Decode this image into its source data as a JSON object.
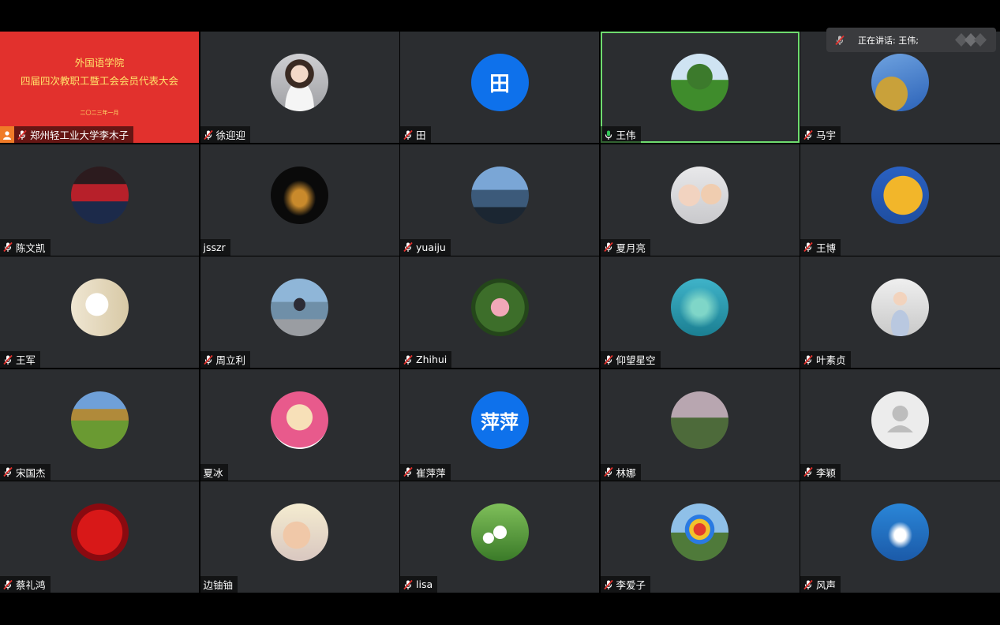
{
  "speaking": {
    "text": "正在讲话: 王伟;",
    "mic_icon": "muted-mic-icon",
    "logo": "app-logo"
  },
  "share": {
    "title_line1": "外国语学院",
    "title_line2": "四届四次教职工暨工会会员代表大会",
    "date": "二〇二三年一月",
    "name": "郑州轻工业大学李木子",
    "host_icon": "person-icon",
    "mic_icon": "muted-mic-icon",
    "bg_color": "#e2312d",
    "title_color": "#ffe36a"
  },
  "participants": [
    {
      "name": "徐迎迎",
      "mic": "muted",
      "avatar": "photo",
      "avatar_kind": "woman-portrait"
    },
    {
      "name": "田",
      "mic": "muted",
      "avatar": "text",
      "avatar_text": "田"
    },
    {
      "name": "王伟",
      "mic": "speaking",
      "avatar": "photo",
      "avatar_kind": "tree",
      "active": true
    },
    {
      "name": "马宇",
      "mic": "muted",
      "avatar": "photo",
      "avatar_kind": "autumn-trees"
    },
    {
      "name": "陈文凯",
      "mic": "muted",
      "avatar": "photo",
      "avatar_kind": "auditorium"
    },
    {
      "name": "jsszr",
      "mic": "none",
      "avatar": "photo",
      "avatar_kind": "calligraphy"
    },
    {
      "name": "yuaiju",
      "mic": "muted",
      "avatar": "photo",
      "avatar_kind": "city"
    },
    {
      "name": "夏月亮",
      "mic": "muted",
      "avatar": "photo",
      "avatar_kind": "mother-child"
    },
    {
      "name": "王博",
      "mic": "muted",
      "avatar": "photo",
      "avatar_kind": "ginkgo"
    },
    {
      "name": "王军",
      "mic": "muted",
      "avatar": "photo",
      "avatar_kind": "lily"
    },
    {
      "name": "周立利",
      "mic": "muted",
      "avatar": "photo",
      "avatar_kind": "seaside"
    },
    {
      "name": "Zhihui",
      "mic": "muted",
      "avatar": "photo",
      "avatar_kind": "rose"
    },
    {
      "name": "仰望星空",
      "mic": "muted",
      "avatar": "photo",
      "avatar_kind": "teal-sky"
    },
    {
      "name": "叶素贞",
      "mic": "muted",
      "avatar": "photo",
      "avatar_kind": "child"
    },
    {
      "name": "宋国杰",
      "mic": "muted",
      "avatar": "photo",
      "avatar_kind": "field"
    },
    {
      "name": "夏冰",
      "mic": "none",
      "avatar": "photo",
      "avatar_kind": "cartoon"
    },
    {
      "name": "崔萍萍",
      "mic": "muted",
      "avatar": "text",
      "avatar_text": "萍萍"
    },
    {
      "name": "林娜",
      "mic": "muted",
      "avatar": "photo",
      "avatar_kind": "forest"
    },
    {
      "name": "李颖",
      "mic": "muted",
      "avatar": "photo",
      "avatar_kind": "default-user"
    },
    {
      "name": "蔡礼鸿",
      "mic": "muted",
      "avatar": "photo",
      "avatar_kind": "red-roses"
    },
    {
      "name": "边铀铀",
      "mic": "none",
      "avatar": "photo",
      "avatar_kind": "baby"
    },
    {
      "name": "lisa",
      "mic": "muted",
      "avatar": "photo",
      "avatar_kind": "white-flowers"
    },
    {
      "name": "李爱子",
      "mic": "muted",
      "avatar": "photo",
      "avatar_kind": "colorful-ball"
    },
    {
      "name": "风声",
      "mic": "muted",
      "avatar": "photo",
      "avatar_kind": "blue-sky"
    }
  ]
}
